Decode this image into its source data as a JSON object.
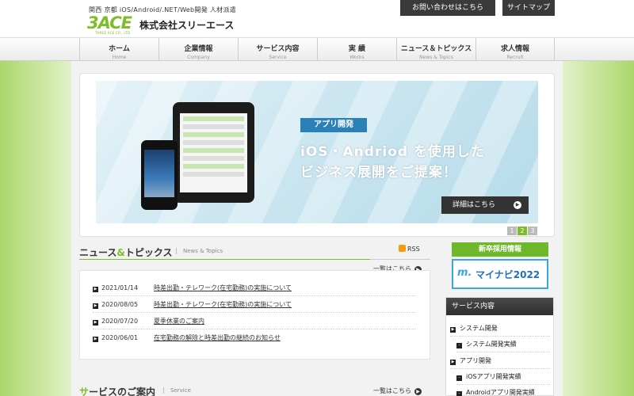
{
  "header": {
    "tagline": "関西 京都 iOS/Android/.NET/Web開発 人材派遣",
    "logo_text": "3ACE",
    "logo_sub": "THREE ACE CO., LTD.",
    "company_name": "株式会社スリーエース",
    "contact_label": "お問い合わせはこちら",
    "sitemap_label": "サイトマップ"
  },
  "nav": [
    {
      "ja": "ホーム",
      "en": "Home"
    },
    {
      "ja": "企業情報",
      "en": "Company"
    },
    {
      "ja": "サービス内容",
      "en": "Service"
    },
    {
      "ja": "実 績",
      "en": "Works"
    },
    {
      "ja": "ニュース＆トピックス",
      "en": "News & Topics"
    },
    {
      "ja": "求人情報",
      "en": "Recruit"
    }
  ],
  "banner": {
    "pill": "アプリ開発",
    "line1": "iOS・Andriod を使用した",
    "line2": "ビジネス展開をご提案！",
    "detail_label": "詳細はこちら",
    "pages": [
      "1",
      "2",
      "3"
    ],
    "active_page": "2"
  },
  "news": {
    "title_a": "ニュース",
    "title_amp": "&",
    "title_b": "トピックス",
    "title_en": "News & Topics",
    "rss": "RSS",
    "all_label": "一覧はこちら",
    "items": [
      {
        "date": "2021/01/14",
        "title": "時差出勤・テレワーク(在宅勤務)の実施について"
      },
      {
        "date": "2020/08/05",
        "title": "時差出勤・テレワーク(在宅勤務)の実施について"
      },
      {
        "date": "2020/07/20",
        "title": "夏季休業のご案内"
      },
      {
        "date": "2020/06/01",
        "title": "在宅勤務の解除と時差出勤の継続のお知らせ"
      }
    ]
  },
  "service": {
    "title_s": "サ",
    "title_rest": "ービスのご案内",
    "title_en": "Service",
    "all_label": "一覧はこちら"
  },
  "sidebar": {
    "recruit_label": "新卒採用情報",
    "mynavi_mark": "m.",
    "mynavi_text": "マイナビ2022",
    "menu_title": "サービス内容",
    "menu_items": [
      {
        "label": "システム開発",
        "level": 1
      },
      {
        "label": "システム開発実績",
        "level": 2
      },
      {
        "label": "アプリ開発",
        "level": 1
      },
      {
        "label": "iOSアプリ開発実績",
        "level": 2
      },
      {
        "label": "Androidアプリ開発実績",
        "level": 2
      }
    ]
  },
  "colors": {
    "accent": "#7cbd2a",
    "dark": "#333333",
    "banner_blue": "#2a80b9"
  },
  "icons": [
    "arrow-right-icon",
    "rss-icon",
    "square-bullet-icon"
  ]
}
